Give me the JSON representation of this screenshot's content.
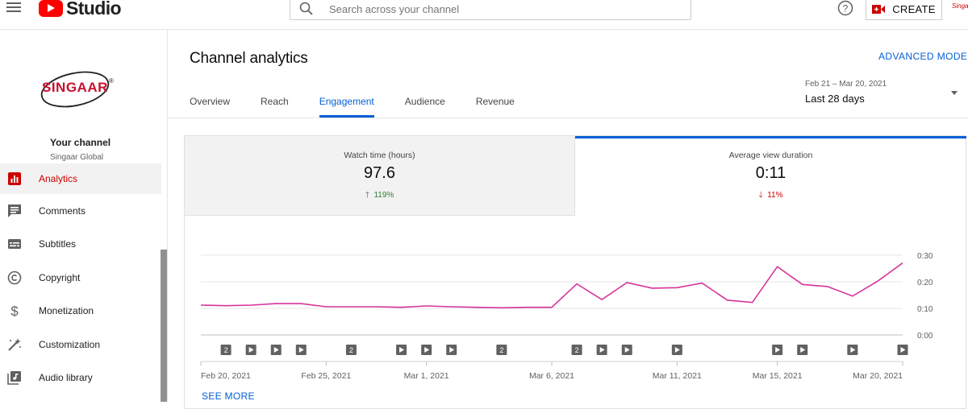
{
  "header": {
    "logo_text": "Studio",
    "search_placeholder": "Search across your channel",
    "create_label": "CREATE",
    "avatar_text": "Singaar"
  },
  "sidebar": {
    "channel_logo_text": "SINGAAR",
    "your_channel_label": "Your channel",
    "channel_name": "Singaar Global",
    "items": [
      {
        "label": "Analytics",
        "icon": "analytics-icon",
        "active": true
      },
      {
        "label": "Comments",
        "icon": "comments-icon",
        "active": false
      },
      {
        "label": "Subtitles",
        "icon": "subtitles-icon",
        "active": false
      },
      {
        "label": "Copyright",
        "icon": "copyright-icon",
        "active": false
      },
      {
        "label": "Monetization",
        "icon": "monetization-icon",
        "active": false
      },
      {
        "label": "Customization",
        "icon": "customization-icon",
        "active": false
      },
      {
        "label": "Audio library",
        "icon": "audio-library-icon",
        "active": false
      }
    ]
  },
  "main": {
    "title": "Channel analytics",
    "advanced_mode_label": "ADVANCED MODE",
    "tabs": [
      {
        "label": "Overview"
      },
      {
        "label": "Reach"
      },
      {
        "label": "Engagement",
        "active": true
      },
      {
        "label": "Audience"
      },
      {
        "label": "Revenue"
      }
    ],
    "date_range": {
      "range": "Feb 21 – Mar 20, 2021",
      "period": "Last 28 days"
    },
    "metrics": [
      {
        "label": "Watch time (hours)",
        "value": "97.6",
        "change": "119%",
        "direction": "up"
      },
      {
        "label": "Average view duration",
        "value": "0:11",
        "change": "11%",
        "direction": "down",
        "selected": true
      }
    ],
    "see_more_label": "SEE MORE"
  },
  "colors": {
    "accent": "#065fd4",
    "brand_red": "#ff0000",
    "line": "#d6339b",
    "up": "#2e7d32",
    "down": "#cc0000"
  },
  "chart_data": {
    "type": "line",
    "title": "",
    "series": [
      {
        "values": [
          0.112,
          0.11,
          0.112,
          0.118,
          0.118,
          0.106,
          0.106,
          0.106,
          0.104,
          0.109,
          0.106,
          0.104,
          0.102,
          0.104,
          0.104,
          0.192,
          0.133,
          0.197,
          0.176,
          0.178,
          0.195,
          0.131,
          0.122,
          0.257,
          0.19,
          0.182,
          0.146,
          0.202,
          0.271
        ]
      }
    ],
    "x": [
      "Feb 20, 2021",
      "Feb 21",
      "Feb 22",
      "Feb 23",
      "Feb 24",
      "Feb 25, 2021",
      "Feb 26",
      "Feb 27",
      "Feb 28",
      "Mar 1, 2021",
      "Mar 2",
      "Mar 3",
      "Mar 4",
      "Mar 5",
      "Mar 6, 2021",
      "Mar 7",
      "Mar 8",
      "Mar 9",
      "Mar 10",
      "Mar 11, 2021",
      "Mar 12",
      "Mar 13",
      "Mar 14",
      "Mar 15, 2021",
      "Mar 16",
      "Mar 17",
      "Mar 18",
      "Mar 19",
      "Mar 20, 2021"
    ],
    "x_tick_labels": [
      "Feb 20, 2021",
      "Feb 25, 2021",
      "Mar 1, 2021",
      "Mar 6, 2021",
      "Mar 11, 2021",
      "Mar 15, 2021",
      "Mar 20, 2021"
    ],
    "y_tick_labels": [
      "0:00",
      "0:10",
      "0:20",
      "0:30"
    ],
    "ylim": [
      0,
      0.3
    ],
    "grid": true,
    "markers": [
      {
        "x": "Feb 21",
        "kind": "count",
        "label": "2"
      },
      {
        "x": "Feb 22",
        "kind": "video"
      },
      {
        "x": "Feb 23",
        "kind": "video"
      },
      {
        "x": "Feb 24",
        "kind": "video"
      },
      {
        "x": "Feb 26",
        "kind": "count",
        "label": "2"
      },
      {
        "x": "Feb 28",
        "kind": "video"
      },
      {
        "x": "Mar 1, 2021",
        "kind": "video"
      },
      {
        "x": "Mar 2",
        "kind": "video"
      },
      {
        "x": "Mar 4",
        "kind": "count",
        "label": "2"
      },
      {
        "x": "Mar 7",
        "kind": "count",
        "label": "2"
      },
      {
        "x": "Mar 8",
        "kind": "video"
      },
      {
        "x": "Mar 9",
        "kind": "video"
      },
      {
        "x": "Mar 11, 2021",
        "kind": "video"
      },
      {
        "x": "Mar 15, 2021",
        "kind": "video"
      },
      {
        "x": "Mar 16",
        "kind": "video"
      },
      {
        "x": "Mar 18",
        "kind": "video"
      },
      {
        "x": "Mar 20, 2021",
        "kind": "video"
      }
    ]
  }
}
